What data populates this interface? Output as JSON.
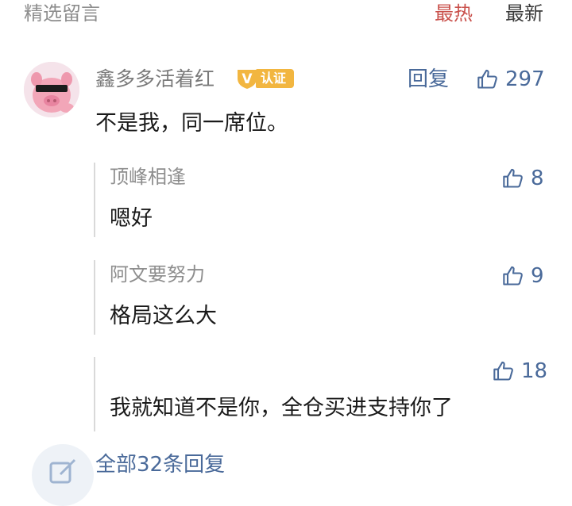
{
  "header": {
    "title": "精选留言",
    "sort_hot": "最热",
    "sort_new": "最新"
  },
  "comment": {
    "user": "鑫多多活着红",
    "badge": {
      "letter": "V",
      "label": "认证"
    },
    "reply_label": "回复",
    "likes": "297",
    "text": "不是我，同一席位。"
  },
  "replies": [
    {
      "user": "顶峰相逢",
      "text": "嗯好",
      "likes": "8"
    },
    {
      "user": "阿文要努力",
      "text": "格局这么大",
      "likes": "9"
    },
    {
      "user": "",
      "text": "我就知道不是你，全仓买进支持你了",
      "likes": "18"
    }
  ],
  "footer": {
    "all_replies": "全部32条回复"
  },
  "colors": {
    "accent_blue": "#4a6a9a",
    "hot_red": "#c9504b",
    "badge_orange": "#f2b640"
  }
}
